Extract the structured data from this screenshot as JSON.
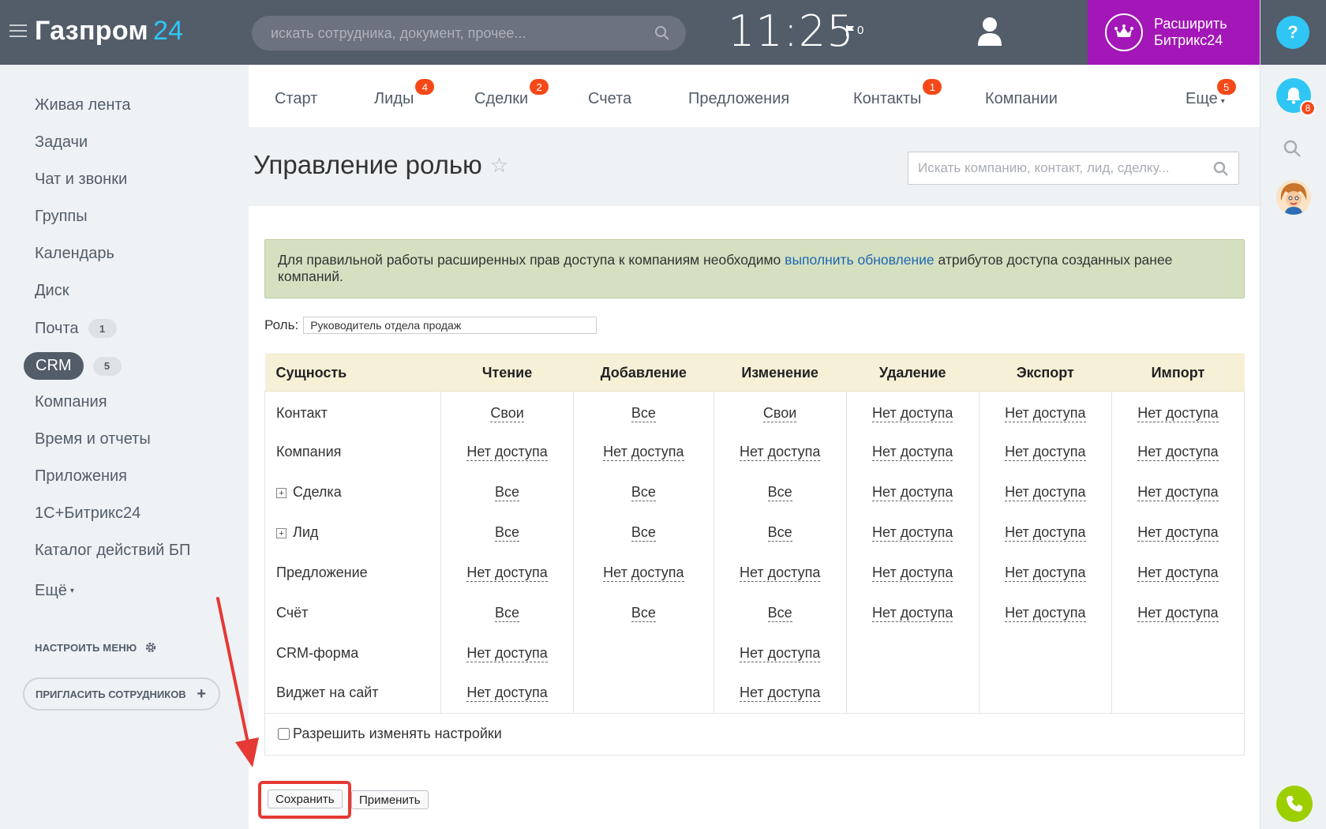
{
  "header": {
    "brand": "Газпром",
    "brand_num": "24",
    "search_placeholder": "искать сотрудника, документ, прочее...",
    "time": "11:25",
    "flag_count": "0",
    "expand_label_line1": "Расширить",
    "expand_label_line2": "Битрикс24"
  },
  "right_panel": {
    "help": "?",
    "notifications_count": "8"
  },
  "sidebar": {
    "items": [
      {
        "label": "Живая лента"
      },
      {
        "label": "Задачи"
      },
      {
        "label": "Чат и звонки"
      },
      {
        "label": "Группы"
      },
      {
        "label": "Календарь"
      },
      {
        "label": "Диск"
      },
      {
        "label": "Почта",
        "counter": "1"
      },
      {
        "label": "CRM",
        "counter": "5"
      },
      {
        "label": "Компания"
      },
      {
        "label": "Время и отчеты"
      },
      {
        "label": "Приложения"
      },
      {
        "label": "1С+Битрикс24"
      },
      {
        "label": "Каталог действий БП"
      },
      {
        "label": "Ещё"
      }
    ],
    "configure": "НАСТРОИТЬ МЕНЮ",
    "invite": "ПРИГЛАСИТЬ СОТРУДНИКОВ"
  },
  "tabs": [
    {
      "label": "Старт"
    },
    {
      "label": "Лиды",
      "badge": "4"
    },
    {
      "label": "Сделки",
      "badge": "2"
    },
    {
      "label": "Счета"
    },
    {
      "label": "Предложения"
    },
    {
      "label": "Контакты",
      "badge": "1"
    },
    {
      "label": "Компании"
    },
    {
      "label": "Еще",
      "badge": "5"
    }
  ],
  "page": {
    "title": "Управление ролью",
    "crm_search_placeholder": "Искать компанию, контакт, лид, сделку..."
  },
  "notice": {
    "before": "Для правильной работы расширенных прав доступа к компаниям необходимо ",
    "link": "выполнить обновление",
    "after": " атрибутов доступа созданных ранее компаний."
  },
  "role": {
    "label": "Роль:",
    "value": "Руководитель отдела продаж"
  },
  "table": {
    "headers": [
      "Сущность",
      "Чтение",
      "Добавление",
      "Изменение",
      "Удаление",
      "Экспорт",
      "Импорт"
    ],
    "rows": [
      {
        "entity": "Контакт",
        "expandable": false,
        "cells": [
          "Свои",
          "Все",
          "Свои",
          "Нет доступа",
          "Нет доступа",
          "Нет доступа"
        ]
      },
      {
        "entity": "Компания",
        "expandable": false,
        "cells": [
          "Нет доступа",
          "Нет доступа",
          "Нет доступа",
          "Нет доступа",
          "Нет доступа",
          "Нет доступа"
        ]
      },
      {
        "entity": "Сделка",
        "expandable": true,
        "cells": [
          "Все",
          "Все",
          "Все",
          "Нет доступа",
          "Нет доступа",
          "Нет доступа"
        ]
      },
      {
        "entity": "Лид",
        "expandable": true,
        "cells": [
          "Все",
          "Все",
          "Все",
          "Нет доступа",
          "Нет доступа",
          "Нет доступа"
        ]
      },
      {
        "entity": "Предложение",
        "expandable": false,
        "cells": [
          "Нет доступа",
          "Нет доступа",
          "Нет доступа",
          "Нет доступа",
          "Нет доступа",
          "Нет доступа"
        ]
      },
      {
        "entity": "Счёт",
        "expandable": false,
        "cells": [
          "Все",
          "Все",
          "Все",
          "Нет доступа",
          "Нет доступа",
          "Нет доступа"
        ]
      },
      {
        "entity": "CRM-форма",
        "expandable": false,
        "cells": [
          "Нет доступа",
          "",
          "Нет доступа",
          "",
          "",
          ""
        ]
      },
      {
        "entity": "Виджет на сайт",
        "expandable": false,
        "cells": [
          "Нет доступа",
          "",
          "Нет доступа",
          "",
          "",
          ""
        ]
      }
    ],
    "allow_settings": "Разрешить изменять настройки"
  },
  "buttons": {
    "save": "Сохранить",
    "apply": "Применить"
  },
  "colors": {
    "header_bg": "#535c69",
    "accent": "#2fc6f6",
    "expand_bg": "#a316b7",
    "badge": "#f54819",
    "highlight": "#e53935"
  }
}
